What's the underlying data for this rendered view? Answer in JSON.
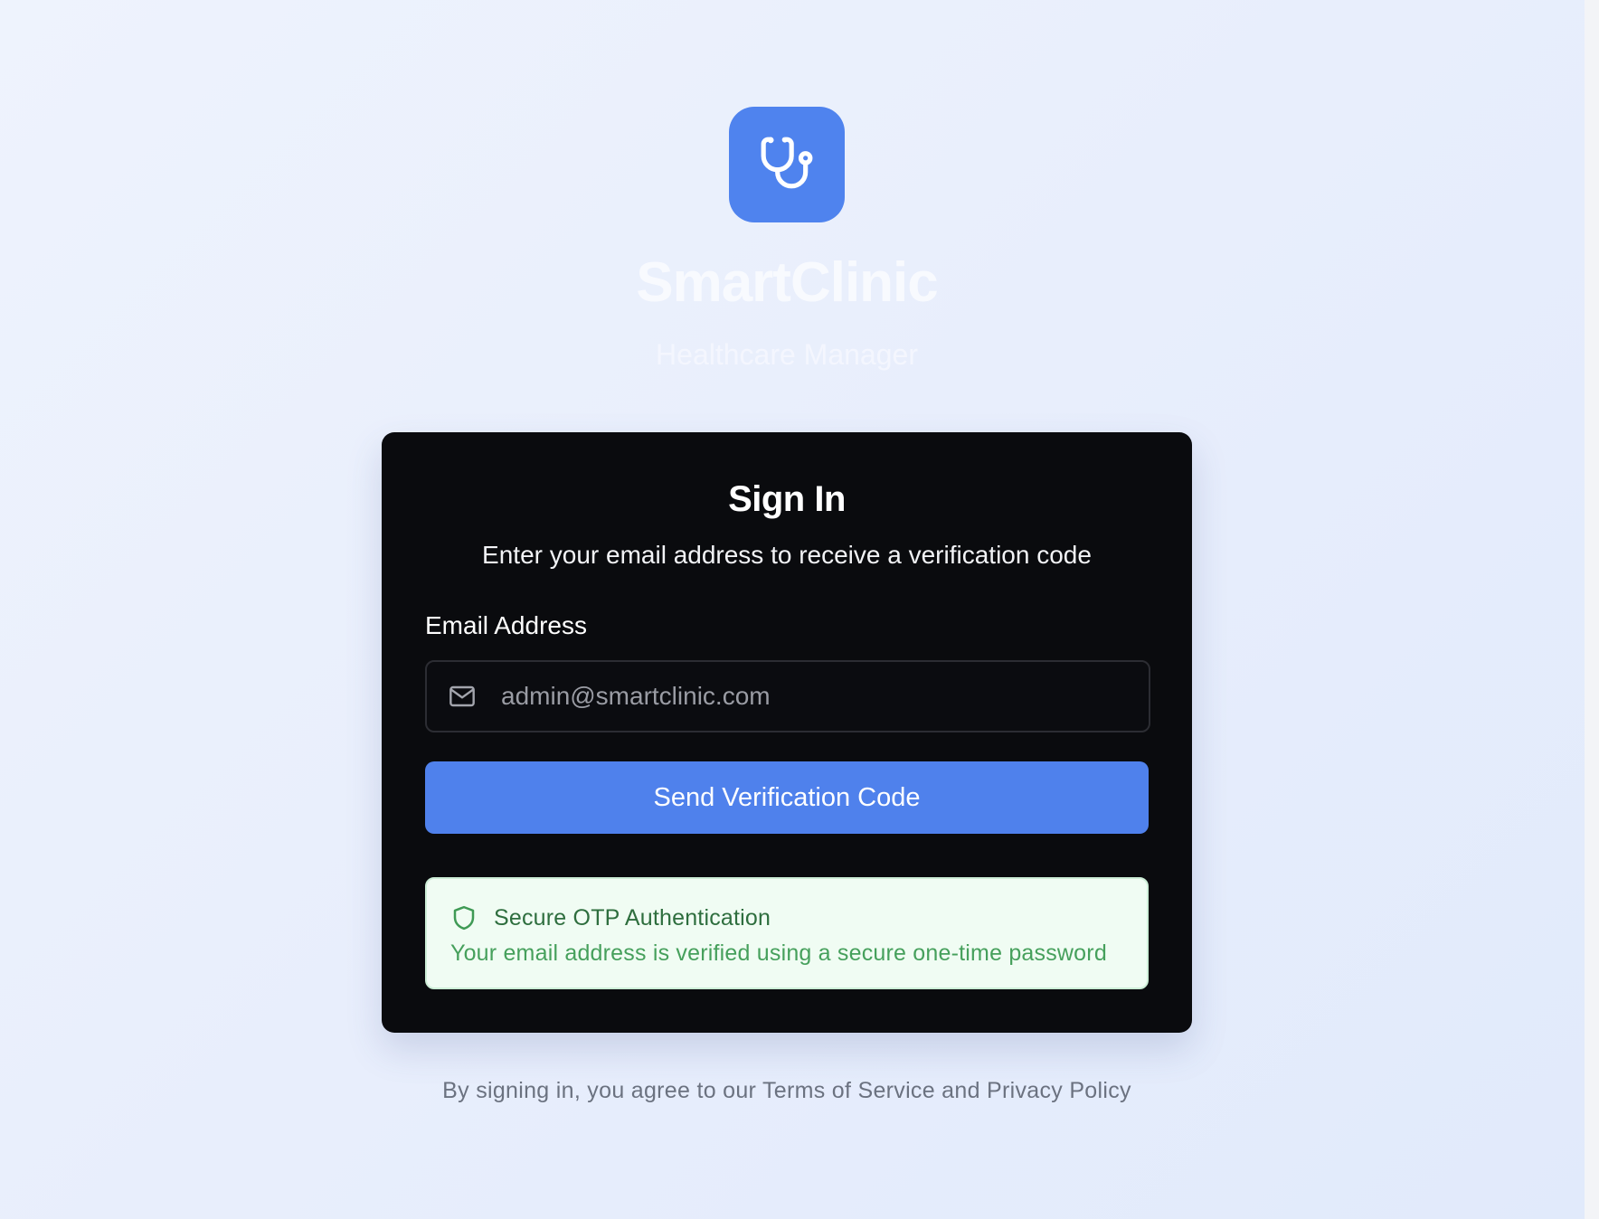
{
  "brand": {
    "logo_icon": "stethoscope-icon",
    "logo_color": "#4f83ee",
    "title": "SmartClinic",
    "subtitle": "Healthcare Manager"
  },
  "card": {
    "title": "Sign In",
    "subtitle": "Enter your email address to receive a verification code",
    "email": {
      "label": "Email Address",
      "icon": "mail-icon",
      "value": "",
      "placeholder": "admin@smartclinic.com"
    },
    "submit_label": "Send Verification Code",
    "accent": "#4f81ec",
    "otp_notice": {
      "icon": "shield-icon",
      "title": "Secure OTP Authentication",
      "description": "Your email address is verified using a secure one-time password",
      "color": "#46a05c"
    }
  },
  "footer": {
    "note": "By signing in, you agree to our Terms of Service and Privacy Policy"
  }
}
